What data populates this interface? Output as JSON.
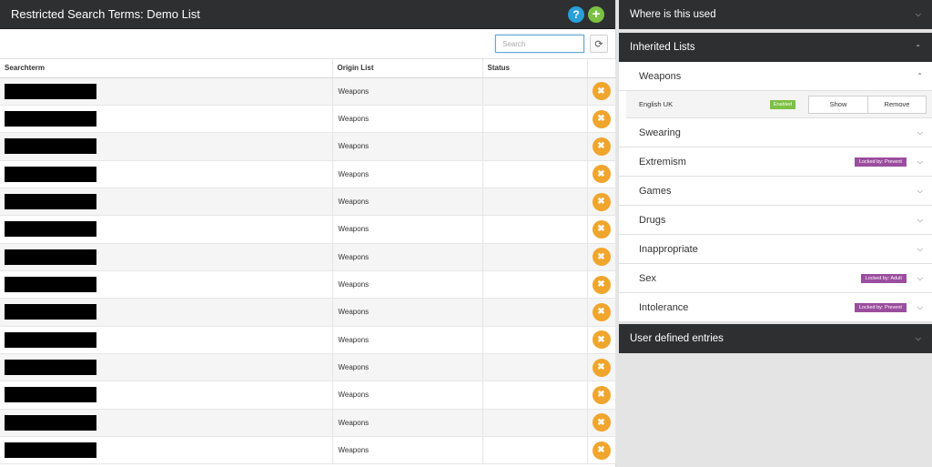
{
  "left_panel": {
    "title": "Restricted Search Terms: Demo List",
    "help_symbol": "?",
    "add_symbol": "+",
    "search_placeholder": "Search",
    "refresh_symbol": "⟳",
    "columns": [
      "Searchterm",
      "Origin List",
      "Status"
    ],
    "rows": [
      {
        "origin": "Weapons",
        "status": ""
      },
      {
        "origin": "Weapons",
        "status": ""
      },
      {
        "origin": "Weapons",
        "status": ""
      },
      {
        "origin": "Weapons",
        "status": ""
      },
      {
        "origin": "Weapons",
        "status": ""
      },
      {
        "origin": "Weapons",
        "status": ""
      },
      {
        "origin": "Weapons",
        "status": ""
      },
      {
        "origin": "Weapons",
        "status": ""
      },
      {
        "origin": "Weapons",
        "status": ""
      },
      {
        "origin": "Weapons",
        "status": ""
      },
      {
        "origin": "Weapons",
        "status": ""
      },
      {
        "origin": "Weapons",
        "status": ""
      },
      {
        "origin": "Weapons",
        "status": ""
      },
      {
        "origin": "Weapons",
        "status": ""
      }
    ],
    "delete_symbol": "✖"
  },
  "right_panel": {
    "where_used": "Where is this used",
    "inherited_lists_title": "Inherited Lists",
    "lists": [
      {
        "name": "Weapons",
        "expanded": true,
        "badge": ""
      },
      {
        "name": "Swearing",
        "expanded": false,
        "badge": ""
      },
      {
        "name": "Extremism",
        "expanded": false,
        "badge": "Locked by: Prevent"
      },
      {
        "name": "Games",
        "expanded": false,
        "badge": ""
      },
      {
        "name": "Drugs",
        "expanded": false,
        "badge": ""
      },
      {
        "name": "Inappropriate",
        "expanded": false,
        "badge": ""
      },
      {
        "name": "Sex",
        "expanded": false,
        "badge": "Locked by: Adult"
      },
      {
        "name": "Intolerance",
        "expanded": false,
        "badge": "Locked by: Prevent"
      }
    ],
    "weapons_sub": {
      "name": "English UK",
      "status": "Enabled",
      "show_label": "Show",
      "remove_label": "Remove"
    },
    "user_defined": "User defined entries"
  },
  "colors": {
    "header_dark": "#2d2f31",
    "help_blue": "#2a9fd8",
    "add_green": "#7cc142",
    "delete_orange": "#f0a52c",
    "locked_purple": "#9b4d9e",
    "enabled_green": "#7cc142"
  },
  "icons": {
    "help": "help-icon",
    "add": "add-icon",
    "refresh": "refresh-icon",
    "delete": "delete-icon",
    "chevron_up": "chevron-up-icon",
    "chevron_down": "chevron-down-icon"
  }
}
